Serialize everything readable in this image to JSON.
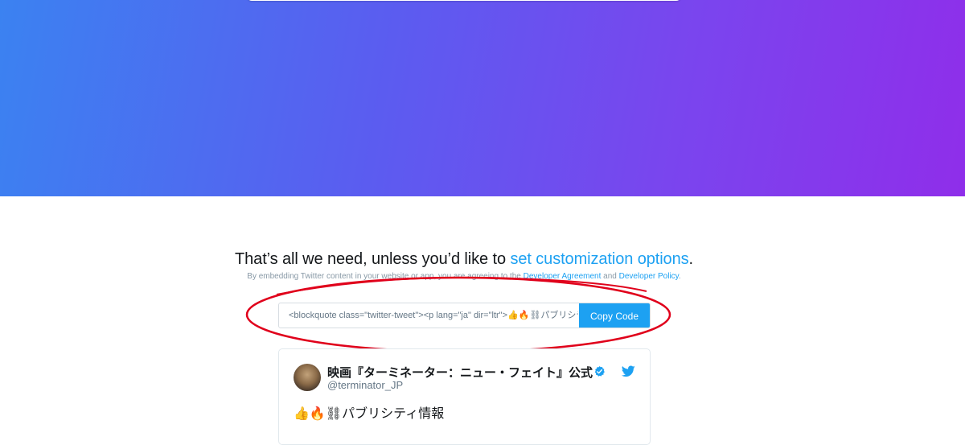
{
  "headline": {
    "prefix": "That’s all we need, unless you’d like to ",
    "link": "set customization options",
    "suffix": "."
  },
  "legal": {
    "prefix": "By embedding Twitter content in your website or app, you are agreeing to the ",
    "agreement_link": "Developer Agreement",
    "middle": " and ",
    "policy_link": "Developer Policy",
    "suffix": "."
  },
  "embed": {
    "code": "<blockquote class=\"twitter-tweet\"><p lang=\"ja\" dir=\"ltr\">👍🔥⛓パブリシティ情報",
    "copy_label": "Copy Code"
  },
  "tweet": {
    "display_name": "映画『ターミネーター：ニュー・フェイト』公式",
    "handle": "@terminator_JP",
    "text": "👍🔥⛓パブリシティ情報"
  },
  "colors": {
    "accent": "#1da1f2",
    "annotation": "#e0001b",
    "gradient_start": "#3b82f1",
    "gradient_end": "#8f2eea"
  },
  "icons": [
    "verified-badge-icon",
    "twitter-bird-icon"
  ]
}
